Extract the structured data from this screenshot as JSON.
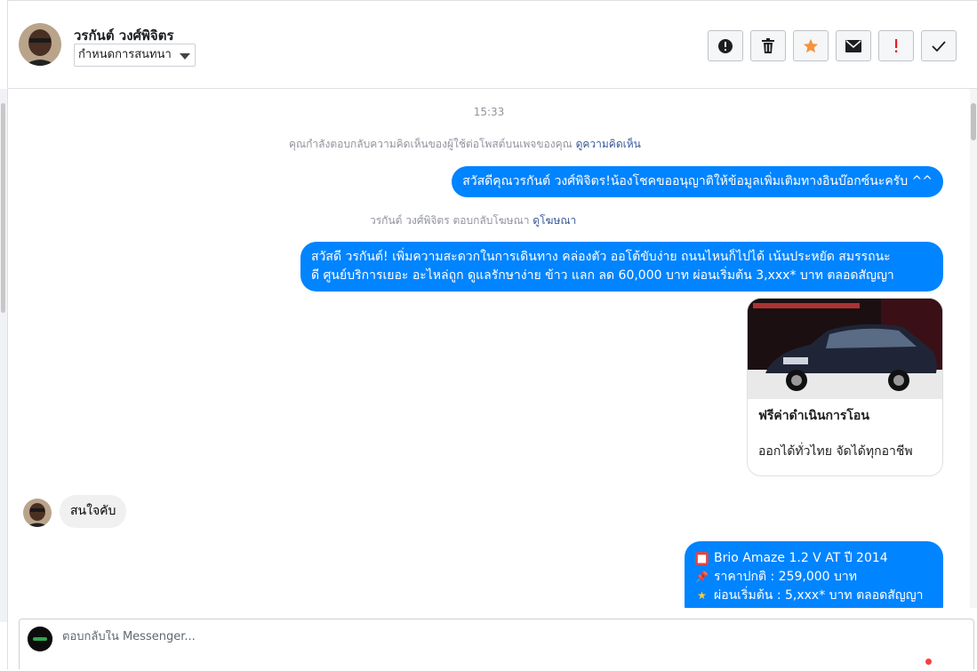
{
  "header": {
    "user_name": "วรกันต์ วงศ์พิจิตร",
    "assign_label": "กำหนดการสนทนา",
    "tools": [
      {
        "name": "spam-button",
        "icon": "exclamation-circle-icon"
      },
      {
        "name": "delete-button",
        "icon": "trash-icon"
      },
      {
        "name": "star-button",
        "icon": "star-icon"
      },
      {
        "name": "mark-unread-button",
        "icon": "envelope-icon"
      },
      {
        "name": "follow-up-button",
        "icon": "exclamation-icon"
      },
      {
        "name": "mark-done-button",
        "icon": "check-icon"
      }
    ]
  },
  "chat": {
    "time": "15:33",
    "comment_notice": "คุณกำลังตอบกลับความคิดเห็นของผู้ใช้ต่อโพสต์บนเพจของคุณ",
    "comment_link": "ดูความคิดเห็น",
    "msg1": "สวัสดีคุณวรกันต์ วงศ์พิจิตร!น้องโชคขออนุญาติให้ข้อมูลเพิ่มเติมทางอินบ๊อกซ์นะครับ ^^",
    "ad_notice": "วรกันต์ วงศ์พิจิตร ตอบกลับโฆษณา",
    "ad_link": "ดูโฆษณา",
    "msg2_line1": "สวัสดี วรกันต์! เพิ่มความสะดวกในการเดินทาง คล่องตัว ออโต้ขับง่าย ถนนไหนก็ไปได้ เน้นประหยัด สมรรถนะ",
    "msg2_line2": "ดี ศูนย์บริการเยอะ อะไหล่ถูก ดูแลรักษาง่าย ข้าว แลก ลด 60,000 บาท ผ่อนเริ่มต้น 3,xxx* บาท ตลอดสัญญา",
    "card": {
      "image_caption": "ฟรีค่าดำเนินการโอน",
      "title": "ฟรีค่าดำเนินการโอน",
      "description": "ออกได้ทั่วไทย จัดได้ทุกอาชีพ"
    },
    "incoming": "สนใจคับ",
    "last_bubble": [
      {
        "icon": "car-emoji",
        "text": "Brio Amaze 1.2 V AT ปี 2014"
      },
      {
        "icon": "pushpin-emoji",
        "text": "ราคาปกติ : 259,000 บาท"
      },
      {
        "icon": "star-emoji",
        "text": "ผ่อนเริ่มต้น : 5,xxx* บาท ตลอดสัญญา"
      }
    ]
  },
  "composer": {
    "placeholder": "ตอบกลับใน Messenger..."
  },
  "colors": {
    "accent": "#0084ff",
    "star": "#f7923b",
    "follow_up": "#e02020"
  }
}
